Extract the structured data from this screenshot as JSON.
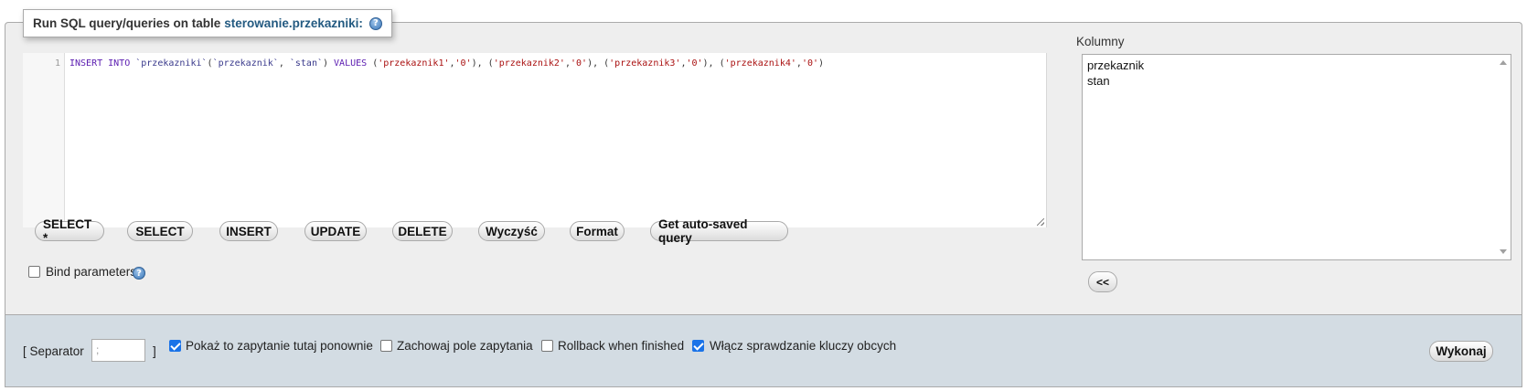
{
  "legend": {
    "prefix": "Run SQL query/queries on table",
    "table": "sterowanie.przekazniki:"
  },
  "editor": {
    "line_number": "1",
    "tokens": [
      {
        "t": "kw",
        "v": "INSERT INTO "
      },
      {
        "t": "id",
        "v": "`przekazniki`"
      },
      {
        "t": "p",
        "v": "("
      },
      {
        "t": "id",
        "v": "`przekaznik`"
      },
      {
        "t": "p",
        "v": ", "
      },
      {
        "t": "id",
        "v": "`stan`"
      },
      {
        "t": "p",
        "v": ") "
      },
      {
        "t": "kw",
        "v": "VALUES "
      },
      {
        "t": "p",
        "v": "("
      },
      {
        "t": "str",
        "v": "'przekaznik1'"
      },
      {
        "t": "p",
        "v": ","
      },
      {
        "t": "str",
        "v": "'0'"
      },
      {
        "t": "p",
        "v": "), ("
      },
      {
        "t": "str",
        "v": "'przekaznik2'"
      },
      {
        "t": "p",
        "v": ","
      },
      {
        "t": "str",
        "v": "'0'"
      },
      {
        "t": "p",
        "v": "), ("
      },
      {
        "t": "str",
        "v": "'przekaznik3'"
      },
      {
        "t": "p",
        "v": ","
      },
      {
        "t": "str",
        "v": "'0'"
      },
      {
        "t": "p",
        "v": "), ("
      },
      {
        "t": "str",
        "v": "'przekaznik4'"
      },
      {
        "t": "p",
        "v": ","
      },
      {
        "t": "str",
        "v": "'0'"
      },
      {
        "t": "p",
        "v": ")"
      }
    ]
  },
  "buttons": {
    "select_star": "SELECT *",
    "select": "SELECT",
    "insert": "INSERT",
    "update": "UPDATE",
    "delete": "DELETE",
    "clear": "Wyczyść",
    "format": "Format",
    "autosaved": "Get auto-saved query",
    "insert_column": "<<",
    "go": "Wykonaj"
  },
  "bind_parameters": {
    "label": "Bind parameters",
    "checked": false
  },
  "columns": {
    "title": "Kolumny",
    "items": [
      "przekaznik",
      "stan"
    ]
  },
  "footer": {
    "separator_open": "[ Separator",
    "separator_value": ";",
    "separator_close": "]",
    "options": [
      {
        "label": "Pokaż to zapytanie tutaj ponownie",
        "checked": true
      },
      {
        "label": "Zachowaj pole zapytania",
        "checked": false
      },
      {
        "label": "Rollback when finished",
        "checked": false
      },
      {
        "label": "Włącz sprawdzanie kluczy obcych",
        "checked": true
      }
    ]
  },
  "help_icon_glyph": "?",
  "colors": {
    "accent": "#235a81",
    "checkbox": "#1a73e8",
    "footer_bg": "#d3dce3",
    "panel_bg": "#eeeeee"
  }
}
